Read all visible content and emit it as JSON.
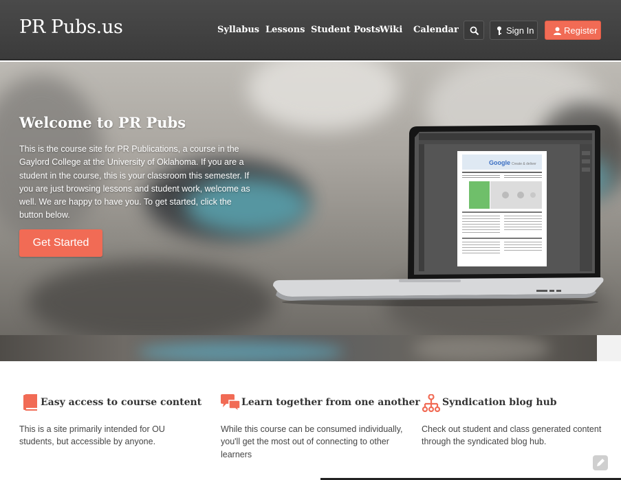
{
  "header": {
    "brand": "PR Pubs.us",
    "nav": [
      "Syllabus",
      "Lessons",
      "Student Posts",
      "Wiki",
      "Calendar"
    ],
    "sign_in_label": "Sign In",
    "register_label": "Register"
  },
  "hero": {
    "title": "Welcome to PR Pubs",
    "text": "This is the course site for PR Publications, a course in the Gaylord College at the University of Oklahoma. If you are a student in the course, this is your classroom this semester. If you are just browsing lessons and student work, welcome as well. We are happy to have you. To get started, click the button below.",
    "cta_label": "Get Started",
    "laptop_screen": {
      "doc_heading": "Google",
      "doc_subheading": "Create & deliver"
    }
  },
  "features": [
    {
      "icon": "book-icon",
      "title": "Easy access to course content",
      "text": "This is a site primarily intended for OU students, but accessible by anyone."
    },
    {
      "icon": "chat-icon",
      "title": "Learn together from one another",
      "text": "While this course can be consumed individually, you'll get the most out of connecting to other learners"
    },
    {
      "icon": "network-icon",
      "title": "Syndication blog hub",
      "text": "Check out student and class generated content through the syndicated blog hub."
    }
  ],
  "colors": {
    "accent": "#f16b55",
    "header_bg": "#444444",
    "heading_text": "#333333",
    "body_text": "#444444"
  }
}
